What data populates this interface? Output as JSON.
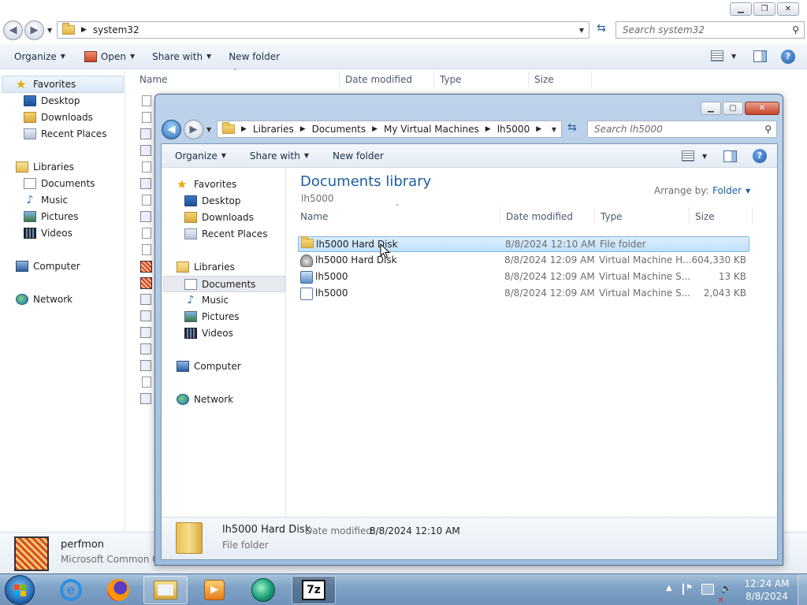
{
  "back_window": {
    "address": {
      "segments": [
        "system32"
      ]
    },
    "search": {
      "placeholder": "Search system32"
    },
    "toolbar": {
      "organize": "Organize",
      "open": "Open",
      "share_with": "Share with",
      "new_folder": "New folder"
    },
    "nav": {
      "favorites": "Favorites",
      "desktop": "Desktop",
      "downloads": "Downloads",
      "recent_places": "Recent Places",
      "libraries": "Libraries",
      "documents": "Documents",
      "music": "Music",
      "pictures": "Pictures",
      "videos": "Videos",
      "computer": "Computer",
      "network": "Network"
    },
    "columns": {
      "name": "Name",
      "date_modified": "Date modified",
      "type": "Type",
      "size": "Size"
    },
    "details": {
      "name": "perfmon",
      "type": "Microsoft Common Co"
    }
  },
  "front_window": {
    "address": {
      "segments": [
        "Libraries",
        "Documents",
        "My Virtual Machines",
        "lh5000"
      ]
    },
    "search": {
      "placeholder": "Search lh5000"
    },
    "toolbar": {
      "organize": "Organize",
      "share_with": "Share with",
      "new_folder": "New folder"
    },
    "nav": {
      "favorites": "Favorites",
      "desktop": "Desktop",
      "downloads": "Downloads",
      "recent_places": "Recent Places",
      "libraries": "Libraries",
      "documents": "Documents",
      "music": "Music",
      "pictures": "Pictures",
      "videos": "Videos",
      "computer": "Computer",
      "network": "Network"
    },
    "library": {
      "title": "Documents library",
      "subtitle": "lh5000",
      "arrange_label": "Arrange by:",
      "arrange_value": "Folder"
    },
    "columns": {
      "name": "Name",
      "date_modified": "Date modified",
      "type": "Type",
      "size": "Size"
    },
    "files": [
      {
        "name": "lh5000 Hard Disk",
        "date": "8/8/2024 12:10 AM",
        "type": "File folder",
        "size": "",
        "icon": "folder-icon",
        "selected": true
      },
      {
        "name": "lh5000 Hard Disk",
        "date": "8/8/2024 12:09 AM",
        "type": "Virtual Machine H...",
        "size": "604,330 KB",
        "icon": "virtual-hard-disk-icon",
        "selected": false
      },
      {
        "name": "lh5000",
        "date": "8/8/2024 12:09 AM",
        "type": "Virtual Machine S...",
        "size": "13 KB",
        "icon": "virtual-machine-settings-icon",
        "selected": false
      },
      {
        "name": "lh5000",
        "date": "8/8/2024 12:09 AM",
        "type": "Virtual Machine S...",
        "size": "2,043 KB",
        "icon": "virtual-machine-config-icon",
        "selected": false
      }
    ],
    "details": {
      "name": "lh5000 Hard Disk",
      "date_label": "Date modified:",
      "date_value": "8/8/2024 12:10 AM",
      "type": "File folder"
    }
  },
  "taskbar": {
    "apps": [
      "start-orb-icon",
      "internet-explorer-icon",
      "firefox-icon",
      "windows-explorer-icon",
      "media-player-icon",
      "virtual-pc-icon",
      "7zip-icon"
    ],
    "seven_zip_label": "7z",
    "time": "12:24 AM",
    "date": "8/8/2024"
  }
}
